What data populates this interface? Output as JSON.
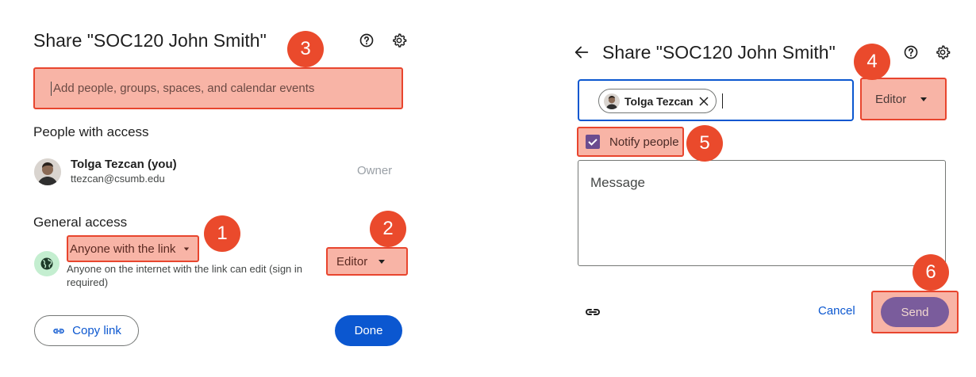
{
  "left": {
    "title": "Share \"SOC120 John Smith\"",
    "add_placeholder": "Add people, groups, spaces, and calendar events",
    "people_header": "People with access",
    "owner": {
      "name": "Tolga Tezcan (you)",
      "email": "ttezcan@csumb.edu",
      "role": "Owner"
    },
    "general_header": "General access",
    "access_option": "Anyone with the link",
    "access_desc": "Anyone on the internet with the link can edit (sign in required)",
    "access_role": "Editor",
    "copy_link": "Copy link",
    "done": "Done"
  },
  "right": {
    "title": "Share \"SOC120 John Smith\"",
    "chip_name": "Tolga Tezcan",
    "role": "Editor",
    "notify_label": "Notify people",
    "notify_checked": true,
    "message_placeholder": "Message",
    "cancel": "Cancel",
    "send": "Send"
  },
  "badges": [
    "1",
    "2",
    "3",
    "4",
    "5",
    "6"
  ],
  "colors": {
    "highlight_fill": "#f8b4a6",
    "highlight_border": "#e8452e",
    "badge": "#ea4a2c",
    "primary": "#0b57d0",
    "send_purple": "#7a5c9c"
  },
  "icons": [
    "help-icon",
    "settings-icon",
    "globe-icon",
    "link-icon",
    "back-arrow-icon",
    "close-icon",
    "checkbox-icon"
  ]
}
